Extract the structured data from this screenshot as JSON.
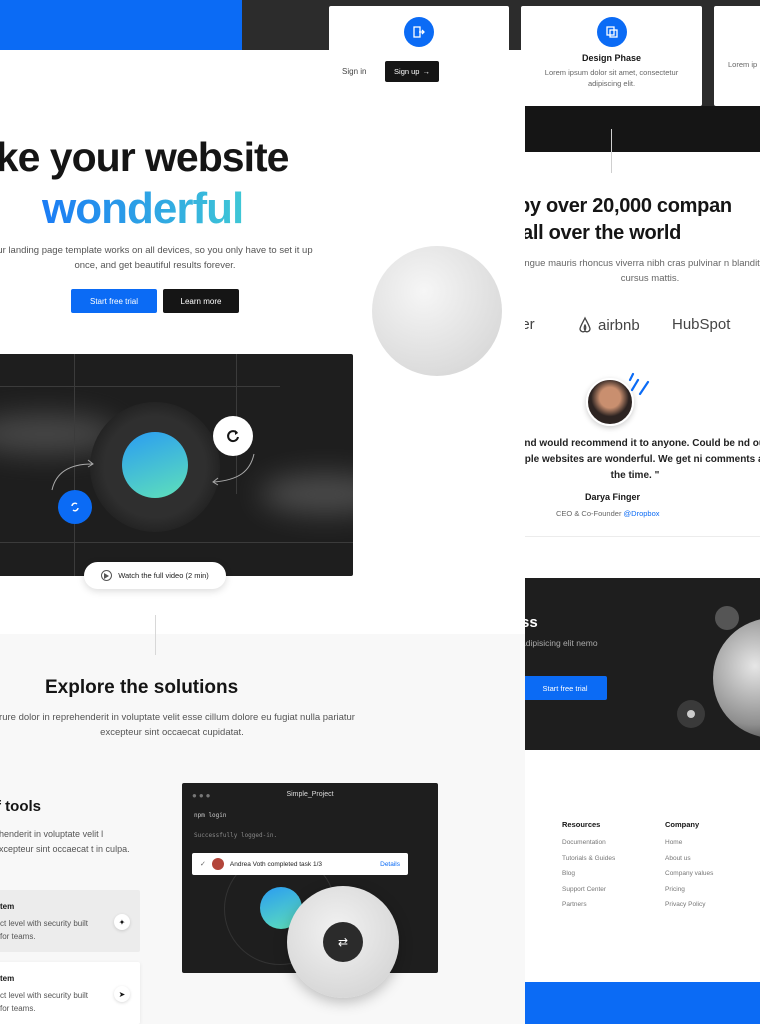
{
  "cards": [
    {
      "title": "",
      "desc": ""
    },
    {
      "title": "Design Phase",
      "desc": "Lorem ipsum dolor sit amet, consectetur adipiscing elit."
    },
    {
      "title": "",
      "desc": "Lorem ip"
    }
  ],
  "nav": {
    "signin": "Sign in",
    "signup": "Sign up"
  },
  "hero": {
    "title_line1": "ake your website",
    "title_line2": "wonderful",
    "subtitle": "ur landing page template works on all devices, so you only have to set it up once, and get beautiful results forever.",
    "primary_btn": "Start free trial",
    "secondary_btn": "Learn more"
  },
  "video": {
    "label_top": "",
    "label_bottom": "",
    "watch_label": "Watch the full video (2 min)"
  },
  "explore": {
    "title": "Explore the solutions",
    "subtitle": "e irure dolor in reprehenderit in voluptate velit esse cillum dolore eu fugiat nulla pariatur excepteur sint occaecat cupidatat."
  },
  "tools": {
    "title": "f tools",
    "desc": "ehenderit in voluptate velit l excepteur sint occaecat t in culpa.",
    "features": [
      {
        "title": "tem",
        "desc": "ct level with security built for teams."
      },
      {
        "title": "tem",
        "desc": "ct level with security built for teams."
      }
    ]
  },
  "terminal": {
    "title": "Simple_Project",
    "line1": "npm login",
    "line2": "Successfully logged-in.",
    "notification": "Andrea Voth completed task 1/3",
    "details": "Details"
  },
  "social": {
    "title_line1": "by over 20,000 compan",
    "title_line2": "all over the world",
    "subtitle": "congue mauris rhoncus viverra nibh cras pulvinar n blandit libero cursus mattis.",
    "logos": [
      "ler",
      "airbnb",
      "HubSpot"
    ]
  },
  "testimonial": {
    "quote": "uct and would recommend it to anyone. Could be nd our multiple websites are wonderful. We get ni comments all the time. \"",
    "name": "Darya Finger",
    "role": "CEO & Co-Founder",
    "company": "@Dropbox"
  },
  "cta": {
    "title": "ss",
    "desc": "adipisicing elit nemo",
    "button": "Start free trial"
  },
  "footer": {
    "resources": {
      "heading": "Resources",
      "links": [
        "Documentation",
        "Tutorials & Guides",
        "Blog",
        "Support Center",
        "Partners"
      ]
    },
    "company": {
      "heading": "Company",
      "links": [
        "Home",
        "About us",
        "Company values",
        "Pricing",
        "Privacy Policy"
      ]
    }
  },
  "colors": {
    "accent": "#0b6bf5",
    "dark": "#151515",
    "gradient_start": "#1b7cf5",
    "gradient_end": "#3fc7d6"
  }
}
